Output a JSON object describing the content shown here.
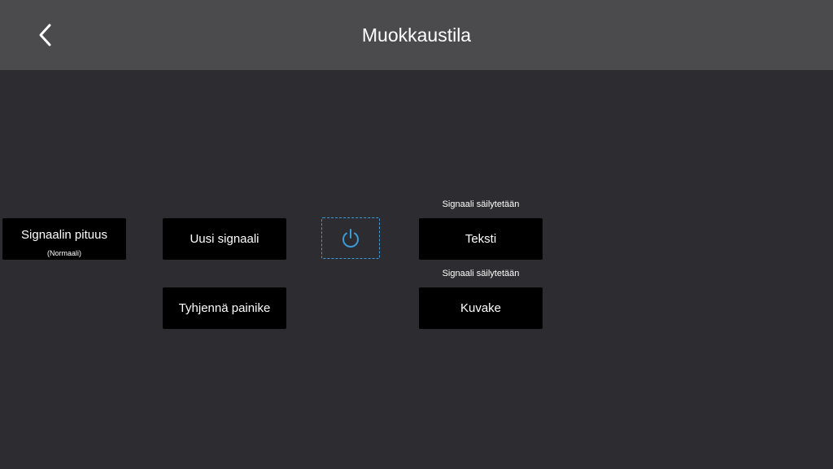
{
  "header": {
    "title": "Muokkaustila",
    "back_icon": "chevron-left-icon"
  },
  "buttons": {
    "signal_length": {
      "label": "Signaalin pituus",
      "sub": "(Normaali)"
    },
    "new_signal": {
      "label": "Uusi signaali"
    },
    "clear_button": {
      "label": "Tyhjennä painike"
    },
    "text": {
      "label": "Teksti",
      "caption": "Signaali säilytetään"
    },
    "icon": {
      "label": "Kuvake",
      "caption": "Signaali säilytetään"
    },
    "power": {
      "icon": "power-icon"
    }
  },
  "colors": {
    "background": "#2d2c30",
    "header": "#4b4b4d",
    "button": "#000000",
    "accent": "#3a9bd9"
  }
}
